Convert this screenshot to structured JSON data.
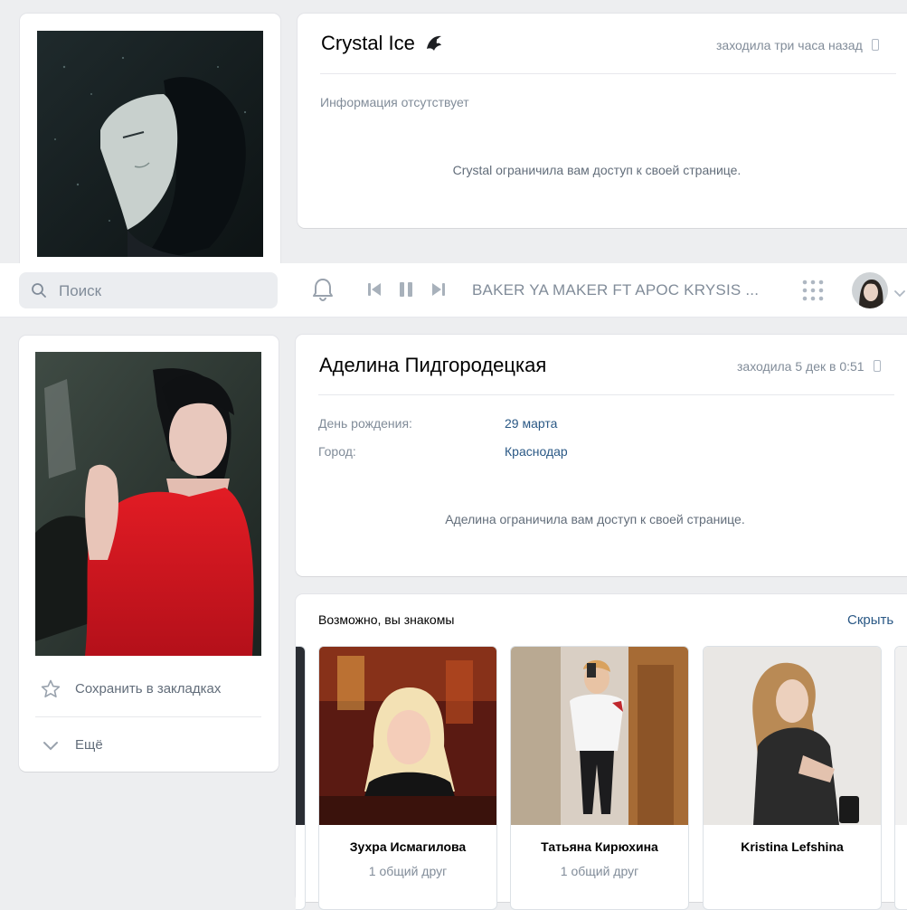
{
  "top_profile": {
    "name": "Crystal Ice",
    "name_emoji_icon": "dragon-emoji-icon",
    "last_seen": "заходила три часа назад",
    "info_missing": "Информация отсутствует",
    "restricted_text": "Crystal ограничила вам доступ к своей странице."
  },
  "header": {
    "search": {
      "placeholder": "Поиск"
    },
    "icons": [
      "bell-icon",
      "previous-track-icon",
      "pause-icon",
      "next-track-icon",
      "apps-grid-icon",
      "chevron-down-icon"
    ],
    "now_playing": "BAKER YA MAKER FT APOC KRYSIS ..."
  },
  "bottom_profile": {
    "name": "Аделина Пидгородецкая",
    "last_seen": "заходила 5 дек в 0:51",
    "fields": [
      {
        "label": "День рождения:",
        "value": "29 марта"
      },
      {
        "label": "Город:",
        "value": "Краснодар"
      }
    ],
    "restricted_text": "Аделина ограничила вам доступ к своей странице.",
    "actions": {
      "bookmark": "Сохранить в закладках",
      "more": "Ещё"
    }
  },
  "suggestions": {
    "title": "Возможно, вы знакомы",
    "hide": "Скрыть",
    "people": [
      {
        "name": "Зухра Исмагилова",
        "mutual": "1 общий друг"
      },
      {
        "name": "Татьяна Кирюхина",
        "mutual": "1 общий друг"
      },
      {
        "name": "Kristina Lefshina",
        "mutual": ""
      }
    ]
  },
  "colors": {
    "link": "#2a5885",
    "muted": "#818c99",
    "background": "#edeef0",
    "accent_red": "#d0121b"
  }
}
